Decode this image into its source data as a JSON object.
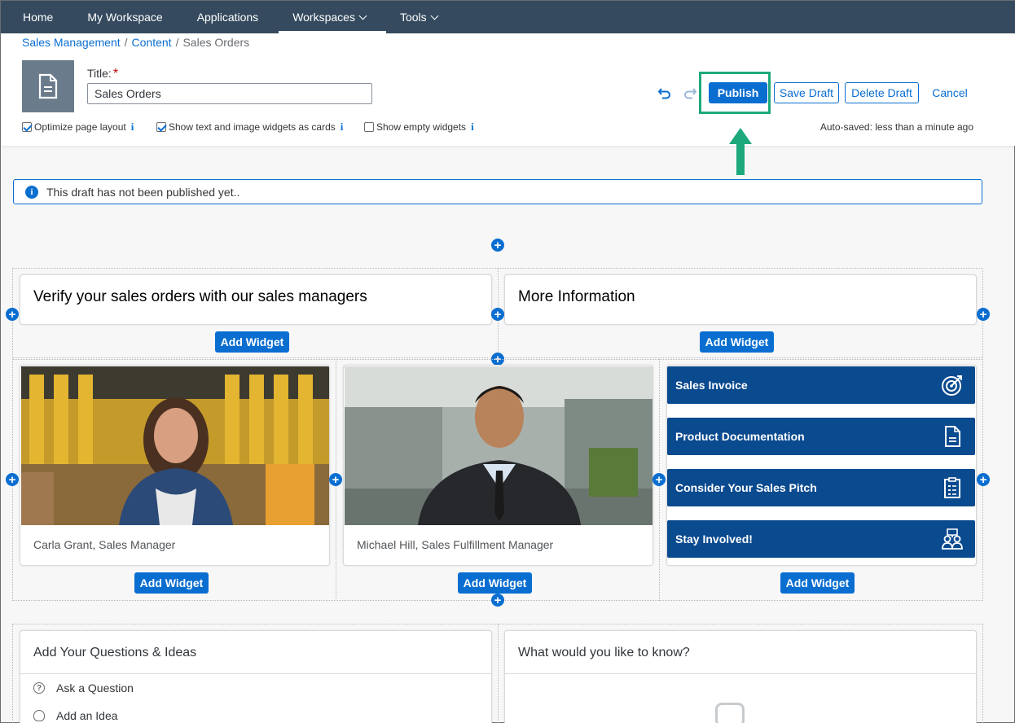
{
  "nav": {
    "items": [
      {
        "label": "Home",
        "dropdown": false
      },
      {
        "label": "My Workspace",
        "dropdown": false
      },
      {
        "label": "Applications",
        "dropdown": false
      },
      {
        "label": "Workspaces",
        "dropdown": true,
        "active": true
      },
      {
        "label": "Tools",
        "dropdown": true
      }
    ]
  },
  "breadcrumb": {
    "items": [
      "Sales Management",
      "Content",
      "Sales Orders"
    ]
  },
  "editor": {
    "title_label": "Title:",
    "required_mark": "*",
    "title_value": "Sales Orders",
    "publish_label": "Publish",
    "save_draft_label": "Save Draft",
    "delete_draft_label": "Delete Draft",
    "cancel_label": "Cancel",
    "options": [
      {
        "label": "Optimize page layout",
        "checked": true
      },
      {
        "label": "Show text and image widgets as cards",
        "checked": true
      },
      {
        "label": "Show empty widgets",
        "checked": false
      }
    ],
    "autosaved": "Auto-saved: less than a minute ago"
  },
  "message": {
    "text": "This draft has not been published yet.."
  },
  "add_widget_label": "Add Widget",
  "cards": {
    "verify_title": "Verify your sales orders with our sales managers",
    "more_info_title": "More Information",
    "person1_caption": "Carla Grant, Sales Manager",
    "person2_caption": "Michael Hill, Sales Fulfillment Manager",
    "links": [
      {
        "label": "Sales Invoice",
        "icon": "target-icon"
      },
      {
        "label": "Product Documentation",
        "icon": "document-icon"
      },
      {
        "label": "Consider Your Sales Pitch",
        "icon": "clipboard-icon"
      },
      {
        "label": "Stay Involved!",
        "icon": "people-icon"
      }
    ],
    "questions_title": "Add Your Questions & Ideas",
    "ask_question": "Ask a Question",
    "add_idea": "Add an Idea",
    "know_title": "What would you like to know?"
  },
  "colors": {
    "nav_bg": "#354a5f",
    "accent": "#0a6ed1",
    "tile_bg": "#0a4a8f",
    "highlight": "#1ea97c"
  }
}
